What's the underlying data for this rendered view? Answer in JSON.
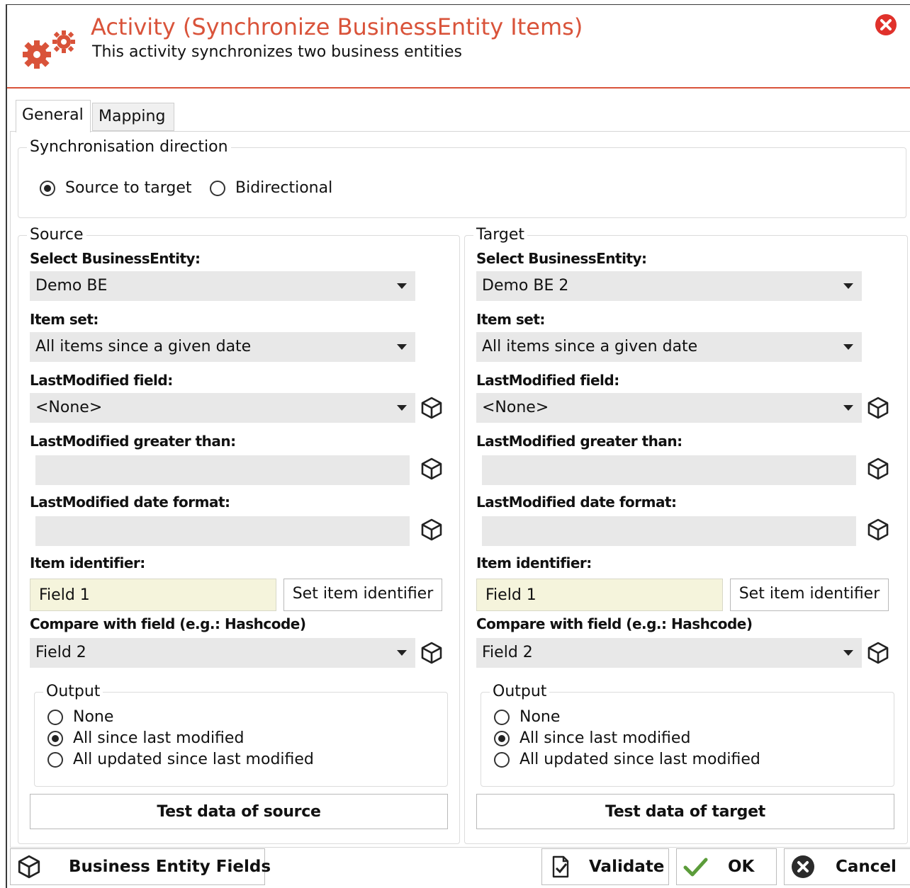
{
  "header": {
    "title": "Activity (Synchronize BusinessEntity Items)",
    "subtitle": "This activity synchronizes two business entities",
    "icon": "gears-icon",
    "accent_color": "#d9533a"
  },
  "tabs": [
    {
      "label": "General",
      "active": true
    },
    {
      "label": "Mapping",
      "active": false
    }
  ],
  "sync_direction": {
    "title": "Synchronisation direction",
    "options": [
      {
        "label": "Source to target",
        "checked": true
      },
      {
        "label": "Bidirectional",
        "checked": false
      }
    ]
  },
  "source": {
    "title": "Source",
    "select_be_label": "Select BusinessEntity:",
    "select_be_value": "Demo BE",
    "item_set_label": "Item set:",
    "item_set_value": "All items since a given date",
    "lastmod_field_label": "LastModified field:",
    "lastmod_field_value": "<None>",
    "lastmod_gt_label": "LastModified greater than:",
    "lastmod_gt_value": "",
    "lastmod_fmt_label": "LastModified date format:",
    "lastmod_fmt_value": "",
    "item_id_label": "Item identifier:",
    "item_id_value": "Field 1",
    "set_item_id_button": "Set item identifier",
    "compare_label": "Compare with field (e.g.: Hashcode)",
    "compare_value": "Field 2",
    "output": {
      "title": "Output",
      "options": [
        {
          "label": "None",
          "checked": false
        },
        {
          "label": "All since last modified",
          "checked": true
        },
        {
          "label": "All updated since last modified",
          "checked": false
        }
      ]
    },
    "test_button": "Test data of source"
  },
  "target": {
    "title": "Target",
    "select_be_label": "Select BusinessEntity:",
    "select_be_value": "Demo BE 2",
    "item_set_label": "Item set:",
    "item_set_value": "All items since a given date",
    "lastmod_field_label": "LastModified field:",
    "lastmod_field_value": "<None>",
    "lastmod_gt_label": "LastModified greater than:",
    "lastmod_gt_value": "",
    "lastmod_fmt_label": "LastModified date format:",
    "lastmod_fmt_value": "",
    "item_id_label": "Item identifier:",
    "item_id_value": "Field 1",
    "set_item_id_button": "Set item identifier",
    "compare_label": "Compare with field (e.g.: Hashcode)",
    "compare_value": "Field 2",
    "output": {
      "title": "Output",
      "options": [
        {
          "label": "None",
          "checked": false
        },
        {
          "label": "All since last modified",
          "checked": true
        },
        {
          "label": "All updated since last modified",
          "checked": false
        }
      ]
    },
    "test_button": "Test data of target"
  },
  "footer": {
    "be_fields_button": "Business Entity Fields",
    "validate_button": "Validate",
    "ok_button": "OK",
    "cancel_button": "Cancel"
  }
}
